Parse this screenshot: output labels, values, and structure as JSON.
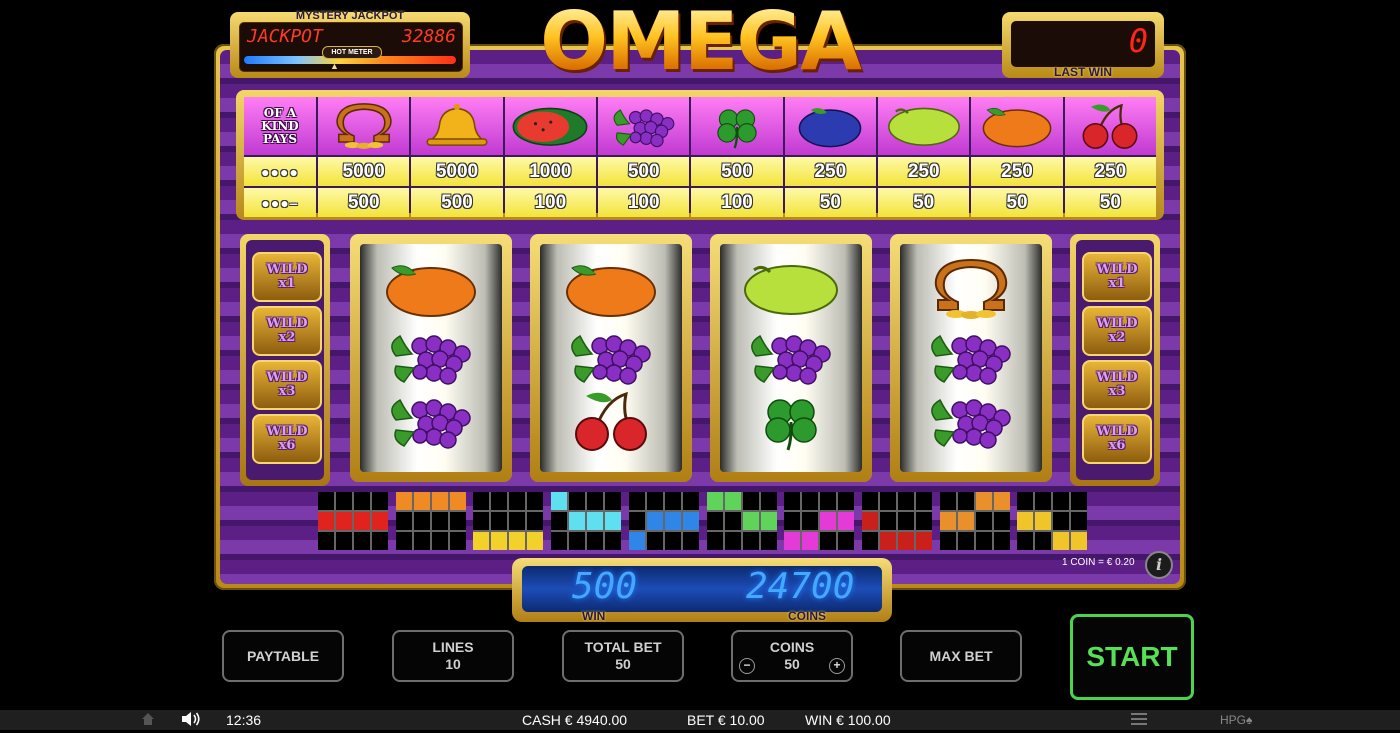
{
  "jackpot": {
    "title": "MYSTERY JACKPOT",
    "label": "JACKPOT",
    "value": "32886",
    "meter_label": "HOT METER"
  },
  "logo": "OMEGA",
  "last_win": {
    "value": "0",
    "label": "LAST WIN"
  },
  "paytable": {
    "header": "OF A KIND PAYS",
    "row_labels": [
      "●●●●",
      "●●●–"
    ],
    "symbols": [
      "omega-icon",
      "bell-icon",
      "watermelon-icon",
      "grapes-icon",
      "clover-icon",
      "plum-icon",
      "lemon-icon",
      "orange-icon",
      "cherries-icon"
    ],
    "four_kind": [
      "5000",
      "5000",
      "1000",
      "500",
      "500",
      "250",
      "250",
      "250",
      "250"
    ],
    "three_kind": [
      "500",
      "500",
      "100",
      "100",
      "100",
      "50",
      "50",
      "50",
      "50"
    ]
  },
  "wilds": {
    "left": [
      {
        "line1": "WILD",
        "line2": "x1"
      },
      {
        "line1": "WILD",
        "line2": "x2"
      },
      {
        "line1": "WILD",
        "line2": "x3"
      },
      {
        "line1": "WILD",
        "line2": "x6"
      }
    ],
    "right": [
      {
        "line1": "WILD",
        "line2": "x1"
      },
      {
        "line1": "WILD",
        "line2": "x2"
      },
      {
        "line1": "WILD",
        "line2": "x3"
      },
      {
        "line1": "WILD",
        "line2": "x6"
      }
    ]
  },
  "reels": [
    [
      "orange-icon",
      "grapes-icon",
      "grapes-icon"
    ],
    [
      "orange-icon",
      "grapes-icon",
      "cherries-icon"
    ],
    [
      "lemon-icon",
      "grapes-icon",
      "clover-icon"
    ],
    [
      "omega-icon",
      "grapes-icon",
      "grapes-icon"
    ]
  ],
  "paylines": [
    {
      "color": "#e0231e",
      "cells": [
        4,
        5,
        6,
        7
      ]
    },
    {
      "color": "#f08a24",
      "cells": [
        0,
        1,
        2,
        3
      ]
    },
    {
      "color": "#f2d12a",
      "cells": [
        8,
        9,
        10,
        11
      ]
    },
    {
      "color": "#5fe0f0",
      "cells": [
        0,
        5,
        6,
        7
      ]
    },
    {
      "color": "#2f86e6",
      "cells": [
        8,
        5,
        6,
        7
      ]
    },
    {
      "color": "#5fd35a",
      "cells": [
        0,
        1,
        6,
        7
      ]
    },
    {
      "color": "#e43bd8",
      "cells": [
        8,
        9,
        6,
        7
      ]
    },
    {
      "color": "#c9201b",
      "cells": [
        4,
        9,
        10,
        11
      ]
    },
    {
      "color": "#e9902a",
      "cells": [
        4,
        5,
        2,
        3
      ]
    },
    {
      "color": "#f0c52a",
      "cells": [
        4,
        5,
        10,
        11
      ]
    }
  ],
  "coin_value": "1 COIN = € 0.20",
  "display": {
    "win_value": "500",
    "win_label": "WIN",
    "coins_value": "24700",
    "coins_label": "COINS"
  },
  "controls": {
    "paytable": "PAYTABLE",
    "lines_label": "LINES",
    "lines_value": "10",
    "total_bet_label": "TOTAL BET",
    "total_bet_value": "50",
    "coins_label": "COINS",
    "coins_value": "50",
    "max_bet": "MAX BET",
    "start": "START"
  },
  "status": {
    "time": "12:36",
    "cash": "CASH € 4940.00",
    "bet": "BET € 10.00",
    "win": "WIN € 100.00",
    "brand": "HPG♠"
  }
}
